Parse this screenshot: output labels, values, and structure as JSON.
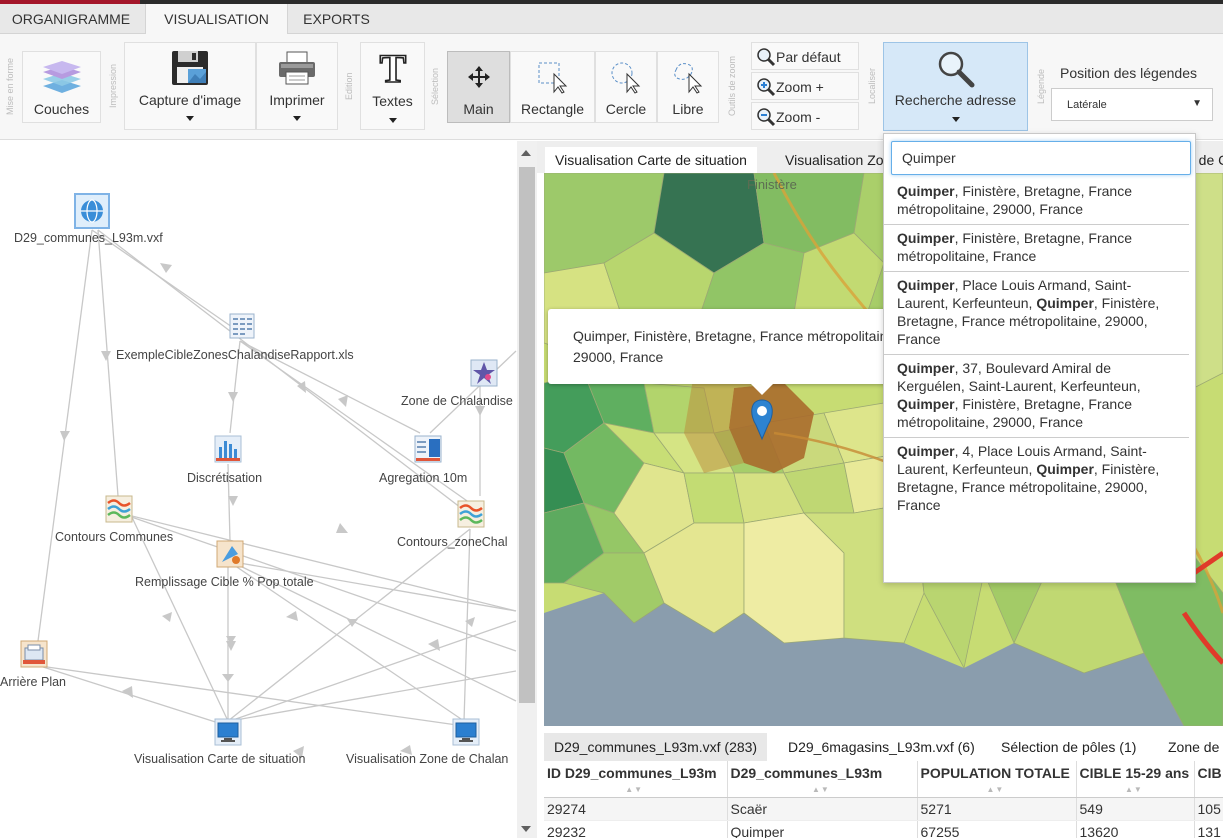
{
  "app": {
    "tabs": [
      "ORGANIGRAMME",
      "VISUALISATION",
      "EXPORTS"
    ],
    "active_tab": "VISUALISATION"
  },
  "ribbon": {
    "groups": [
      "Mise en forme",
      "Impression",
      "Edition",
      "Sélection",
      "Outils de zoom",
      "Localiser",
      "Légende"
    ],
    "couches": "Couches",
    "capture": "Capture d'image",
    "imprimer": "Imprimer",
    "textes": "Textes",
    "main": "Main",
    "rectangle": "Rectangle",
    "cercle": "Cercle",
    "libre": "Libre",
    "zoom_default": "Par défaut",
    "zoom_in": "Zoom +",
    "zoom_out": "Zoom -",
    "recherche": "Recherche adresse",
    "legend_position_label": "Position des légendes",
    "legend_position_value": "Latérale"
  },
  "diagram": {
    "nodes": [
      "D29_communes_L93m.vxf",
      "ExempleCibleZonesChalandiseRapport.xls",
      "Zone de Chalandise",
      "Discrétisation",
      "Agregation 10m",
      "Contours Communes",
      "Contours_zoneChal",
      "Remplissage Cible % Pop totale",
      "Arrière Plan",
      "Visualisation Carte de situation",
      "Visualisation Zone de Chalan"
    ]
  },
  "views": {
    "tabs": [
      "Visualisation Carte de situation",
      "Visualisation Zo",
      "e de C"
    ],
    "active": "Visualisation Carte de situation"
  },
  "map": {
    "region_label": "Finistère",
    "popup_line1": "Quimper, Finistère, Bretagne, France métropolitaine,",
    "popup_line2": "29000, France",
    "colors": {
      "dark_green": "#2f7d4b",
      "light_green": "#c9e07a",
      "yellow": "#e8e49a",
      "quimper": "#a8692a",
      "sea": "#8a9dad"
    }
  },
  "search": {
    "value": "Quimper",
    "results": [
      {
        "bold": "Quimper",
        "text": ", Finistère, Bretagne, France métropolitaine, 29000, France"
      },
      {
        "bold": "Quimper",
        "text": ", Finistère, Bretagne, France métropolitaine, France"
      },
      {
        "bold": "Quimper",
        "text": ", Place Louis Armand, Saint-Laurent, Kerfeunteun, ",
        "bold2": "Quimper",
        "text2": ", Finistère, Bretagne, France métropolitaine, 29000, France"
      },
      {
        "bold": "Quimper",
        "text": ", 37, Boulevard Amiral de Kerguélen, Saint-Laurent, Kerfeunteun, ",
        "bold2": "Quimper",
        "text2": ", Finistère, Bretagne, France métropolitaine, 29000, France"
      },
      {
        "bold": "Quimper",
        "text": ", 4, Place Louis Armand, Saint-Laurent, Kerfeunteun, ",
        "bold2": "Quimper",
        "text2": ", Finistère, Bretagne, France métropolitaine, 29000, France"
      }
    ]
  },
  "table": {
    "tabs": [
      "D29_communes_L93m.vxf (283)",
      "D29_6magasins_L93m.vxf (6)",
      "Sélection de pôles (1)",
      "Zone de"
    ],
    "columns": [
      "ID D29_communes_L93m",
      "D29_communes_L93m",
      "POPULATION TOTALE",
      "CIBLE 15-29 ans",
      "CIB"
    ],
    "rows": [
      [
        "29274",
        "Scaër",
        "5271",
        "549",
        "105"
      ],
      [
        "29232",
        "Quimper",
        "67255",
        "13620",
        "131"
      ]
    ]
  }
}
